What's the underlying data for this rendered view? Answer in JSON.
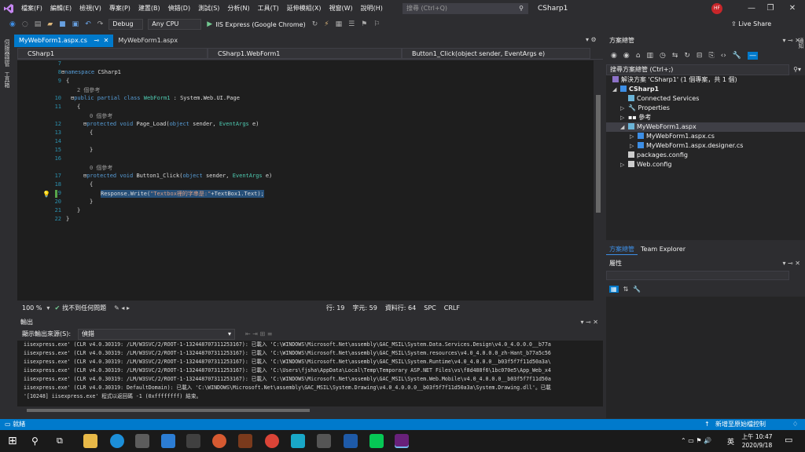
{
  "menubar": {
    "items": [
      "檔案(F)",
      "編輯(E)",
      "檢視(V)",
      "專案(P)",
      "建置(B)",
      "偵錯(D)",
      "測試(S)",
      "分析(N)",
      "工具(T)",
      "延伸模組(X)",
      "視窗(W)",
      "說明(H)"
    ],
    "search_placeholder": "搜尋 (Ctrl+Q)",
    "app_title": "CSharp1",
    "user_initials": "HF"
  },
  "toolbar": {
    "config": "Debug",
    "platform": "Any CPU",
    "run_target": "IIS Express (Google Chrome)",
    "live_share": "Live Share"
  },
  "left_strip": {
    "labels": [
      "伺服器總管",
      "工具箱"
    ]
  },
  "tabs": [
    {
      "label": "MyWebForm1.aspx.cs",
      "active": true
    },
    {
      "label": "MyWebForm1.aspx",
      "active": false
    }
  ],
  "navbar": {
    "project": "CSharp1",
    "class": "CSharp1.WebForm1",
    "member": "Button1_Click(object sender, EventArgs e)"
  },
  "editor": {
    "line_numbers": [
      "7",
      "8",
      "9",
      "10",
      "11",
      "12",
      "13",
      "14",
      "15",
      "16",
      "17",
      "18",
      "19",
      "20",
      "21",
      "22"
    ],
    "lines": {
      "l8_kw": "namespace",
      "l8_name": " CSharp1",
      "l9": "{",
      "ref1": "2 個參考",
      "l10_kw": "public partial class",
      "l10_ty": " WebForm1",
      "l10_rest": " : System.Web.UI.Page",
      "l11": "{",
      "ref2": "0 個參考",
      "l12_kw": "protected void",
      "l12_rest": " Page_Load(",
      "l12_kw2": "object",
      "l12_rest2": " sender, ",
      "l12_ty": "EventArgs",
      "l12_rest3": " e)",
      "l13": "{",
      "l14": "",
      "l15": "}",
      "ref3": "0 個參考",
      "l17_kw": "protected void",
      "l17_rest": " Button1_Click(",
      "l17_kw2": "object",
      "l17_rest2": " sender, ",
      "l17_ty": "EventArgs",
      "l17_rest3": " e)",
      "l18": "{",
      "l19_a": "Response.Write(",
      "l19_str": "\"Textbox裡的字串是:\"",
      "l19_b": "+TextBox1.Text);",
      "l20": "}",
      "l21": "}",
      "l22": "}"
    }
  },
  "editor_status": {
    "zoom": "100 %",
    "issues": "找不到任何問題",
    "line": "行: 19",
    "char": "字元: 59",
    "col": "資料行: 64",
    "spc": "SPC",
    "crlf": "CRLF"
  },
  "output": {
    "title": "輸出",
    "source_label": "顯示輸出來源(S):",
    "source_value": "偵錯",
    "lines": [
      "iisexpress.exe' (CLR v4.0.30319: /LM/W3SVC/2/ROOT-1-132448707311253167): 已載入 'C:\\WINDOWS\\Microsoft.Net\\assembly\\GAC_MSIL\\System.Data.Services.Design\\v4.0_4.0.0.0__b77a",
      "iisexpress.exe' (CLR v4.0.30319: /LM/W3SVC/2/ROOT-1-132448707311253167): 已載入 'C:\\WINDOWS\\Microsoft.Net\\assembly\\GAC_MSIL\\System.resources\\v4.0_4.0.0.0_zh-Hant_b77a5c56",
      "iisexpress.exe' (CLR v4.0.30319: /LM/W3SVC/2/ROOT-1-132448707311253167): 已載入 'C:\\WINDOWS\\Microsoft.Net\\assembly\\GAC_MSIL\\System.Runtime\\v4.0_4.0.0.0__b03f5f7f11d50a3a\\",
      "iisexpress.exe' (CLR v4.0.30319: /LM/W3SVC/2/ROOT-1-132448707311253167): 已載入 'C:\\Users\\fjsha\\AppData\\Local\\Temp\\Temporary ASP.NET Files\\vs\\f8d488f6\\1bc070e5\\App_Web_x4",
      "iisexpress.exe' (CLR v4.0.30319: /LM/W3SVC/2/ROOT-1-132448707311253167): 已載入 'C:\\WINDOWS\\Microsoft.Net\\assembly\\GAC_MSIL\\System.Web.Mobile\\v4.0_4.0.0.0__b03f5f7f11d50a",
      "iisexpress.exe' (CLR v4.0.30319: DefaultDomain): 已載入 'C:\\WINDOWS\\Microsoft.Net\\assembly\\GAC_MSIL\\System.Drawing\\v4.0_4.0.0.0__b03f5f7f11d50a3a\\System.Drawing.dll'。已載",
      "'[10248] iisexpress.exe' 程式以返回碼 -1 (0xffffffff) 結束。"
    ]
  },
  "solution_explorer": {
    "title": "方案總管",
    "search_placeholder": "搜尋方案總管 (Ctrl+;)",
    "items": [
      {
        "label": "解決方案 'CSharp1' (1 個專案，共 1 個)"
      },
      {
        "label": "CSharp1"
      },
      {
        "label": "Connected Services"
      },
      {
        "label": "Properties"
      },
      {
        "label": "參考"
      },
      {
        "label": "MyWebForm1.aspx"
      },
      {
        "label": "MyWebForm1.aspx.cs"
      },
      {
        "label": "MyWebForm1.aspx.designer.cs"
      },
      {
        "label": "packages.config"
      },
      {
        "label": "Web.config"
      }
    ],
    "bottom_tabs": [
      "方案總管",
      "Team Explorer"
    ]
  },
  "properties": {
    "title": "屬性"
  },
  "status": {
    "ready": "就緒",
    "source_control": "新增至原始檔控制"
  },
  "taskbar": {
    "time": "上午 10:47",
    "date": "2020/9/18",
    "ime": "英"
  },
  "colors": {
    "accent": "#007acc",
    "background": "#2d2d30",
    "editor_bg": "#1e1e1e"
  }
}
